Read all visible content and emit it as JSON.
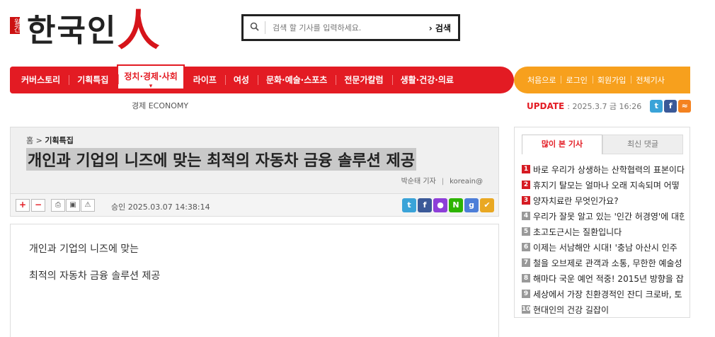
{
  "header": {
    "logo_small": "월간",
    "logo_main": "한국인",
    "logo_accent": "人",
    "search_placeholder": "검색 할 기사를 입력하세요.",
    "search_button": "검색"
  },
  "nav": {
    "items": [
      {
        "label": "커버스토리"
      },
      {
        "label": "기획특집"
      },
      {
        "label": "정치·경제·사회",
        "active": true
      },
      {
        "label": "라이프"
      },
      {
        "label": "여성"
      },
      {
        "label": "문화·예술·스포츠"
      },
      {
        "label": "전문가칼럼"
      },
      {
        "label": "생활·건강·의료"
      }
    ],
    "util": [
      "처음으로",
      "로그인",
      "회원가입",
      "전체기사"
    ],
    "subnav": "경제 ECONOMY",
    "update_label": "UPDATE",
    "update_date": ": 2025.3.7 금 16:26"
  },
  "colors": {
    "brand_red": "#e31b23",
    "util_orange": "#f7a01d"
  },
  "article": {
    "crumb_home": "홈",
    "crumb_section": "기획특집",
    "headline": "개인과 기업의 니즈에 맞는 최적의 자동차 금융 솔루션 제공",
    "reporter": "박순태 기자",
    "email": "koreain@",
    "approved": "승인 2025.03.07  14:38:14",
    "toolbar_plus": "+",
    "toolbar_minus": "−",
    "body": [
      "개인과 기업의 니즈에 맞는",
      "최적의 자동차 금융 솔루션 제공"
    ]
  },
  "sidebar": {
    "tab_popular": "많이 본 기사",
    "tab_comments": "최신 댓글",
    "popular": [
      {
        "n": "1",
        "title": "바로 우리가 상생하는 산학협력의 표본이다"
      },
      {
        "n": "2",
        "title": "휴지기 탈모는 얼마나 오래 지속되며 어떻"
      },
      {
        "n": "3",
        "title": "양자치료란 무엇인가요?"
      },
      {
        "n": "4",
        "title": "우리가 잘못 알고 있는 '인간 허경영'에 대한"
      },
      {
        "n": "5",
        "title": "초고도근시는 질환입니다"
      },
      {
        "n": "6",
        "title": "이제는 서남해안 시대! '충남 아산시 인주"
      },
      {
        "n": "7",
        "title": "철을 오브제로 관객과 소통, 무한한 예술성"
      },
      {
        "n": "8",
        "title": "해마다 국운 예언 적중! 2015년 방향을 잡"
      },
      {
        "n": "9",
        "title": "세상에서 가장 친환경적인 잔디 크로바, 토"
      },
      {
        "n": "10",
        "title": "현대인의 건강 길잡이"
      }
    ]
  }
}
